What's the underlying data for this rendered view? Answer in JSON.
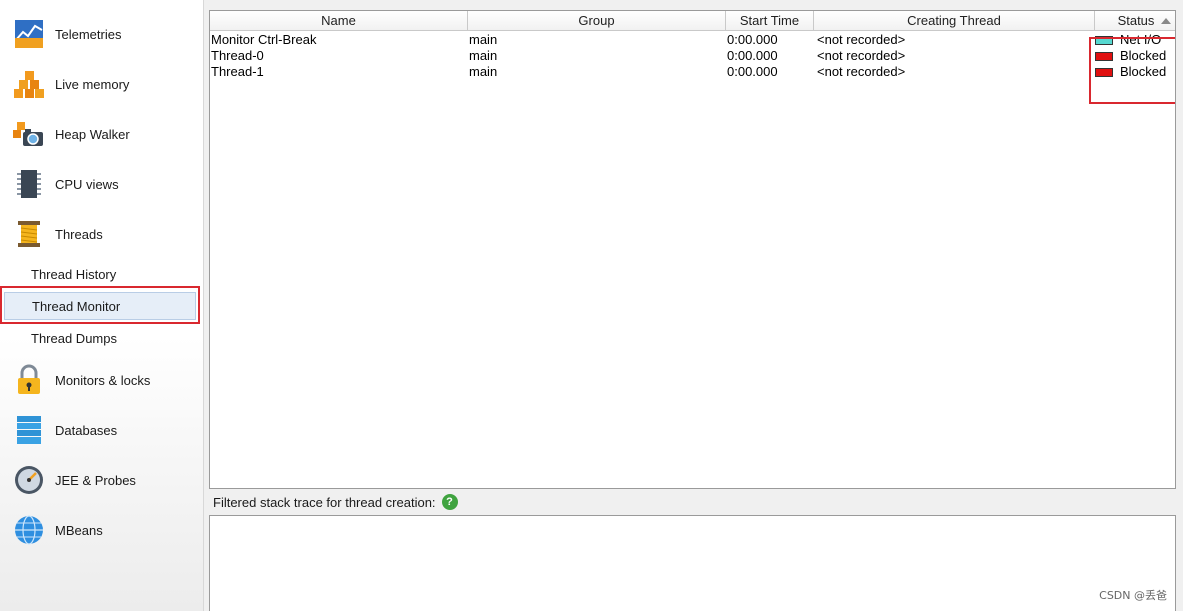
{
  "sidebar": {
    "items": [
      {
        "label": "Telemetries",
        "icon": "telemetries-icon"
      },
      {
        "label": "Live memory",
        "icon": "live-memory-icon"
      },
      {
        "label": "Heap Walker",
        "icon": "heap-walker-icon"
      },
      {
        "label": "CPU views",
        "icon": "cpu-views-icon"
      },
      {
        "label": "Threads",
        "icon": "threads-icon"
      }
    ],
    "sub_items": [
      {
        "label": "Thread History",
        "selected": false
      },
      {
        "label": "Thread Monitor",
        "selected": true
      },
      {
        "label": "Thread Dumps",
        "selected": false
      }
    ],
    "items_after": [
      {
        "label": "Monitors & locks",
        "icon": "lock-icon"
      },
      {
        "label": "Databases",
        "icon": "databases-icon"
      },
      {
        "label": "JEE & Probes",
        "icon": "gauge-icon"
      },
      {
        "label": "MBeans",
        "icon": "globe-icon"
      }
    ]
  },
  "table": {
    "columns": [
      "Name",
      "Group",
      "Start Time",
      "Creating Thread",
      "Status"
    ],
    "rows": [
      {
        "name": "Monitor Ctrl-Break",
        "group": "main",
        "start_time": "0:00.000",
        "creating_thread": "<not recorded>",
        "status": "Net I/O",
        "status_color": "#56d8d0"
      },
      {
        "name": "Thread-0",
        "group": "main",
        "start_time": "0:00.000",
        "creating_thread": "<not recorded>",
        "status": "Blocked",
        "status_color": "#e01010"
      },
      {
        "name": "Thread-1",
        "group": "main",
        "start_time": "0:00.000",
        "creating_thread": "<not recorded>",
        "status": "Blocked",
        "status_color": "#e01010"
      }
    ]
  },
  "lower": {
    "label": "Filtered stack trace for thread creation:",
    "help_icon": "help-icon"
  },
  "watermark": "CSDN @丢爸",
  "colors": {
    "highlight_red": "#d9282f",
    "selection_bg": "#e6eef8"
  }
}
